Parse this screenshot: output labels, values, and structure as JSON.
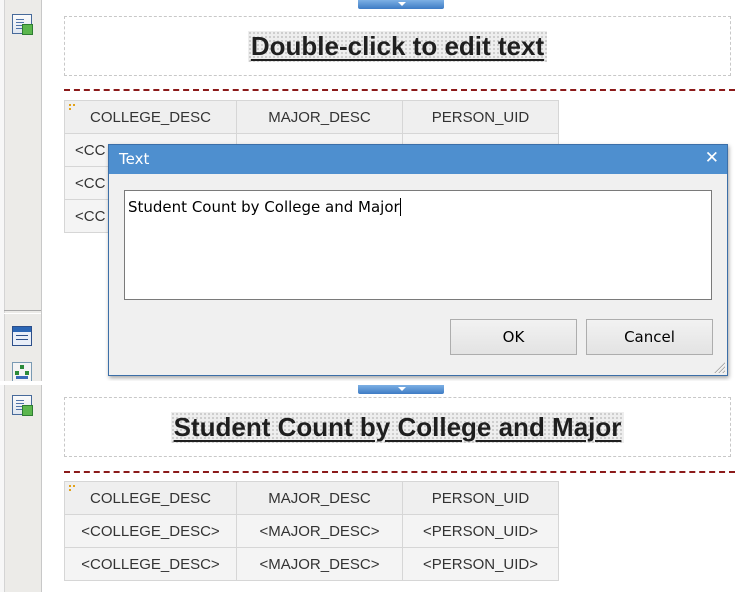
{
  "top_panel": {
    "title_placeholder": "Double-click to edit text",
    "table": {
      "headers": [
        "COLLEGE_DESC",
        "MAJOR_DESC",
        "PERSON_UID"
      ],
      "row_prefix": [
        "<CC",
        "<CC",
        "<CC"
      ]
    },
    "dialog": {
      "title": "Text",
      "close_glyph": "✕",
      "text_value": "Student Count by College and Major",
      "ok_label": "OK",
      "cancel_label": "Cancel"
    }
  },
  "bottom_panel": {
    "title": "Student Count by College and Major",
    "table": {
      "headers": [
        "COLLEGE_DESC",
        "MAJOR_DESC",
        "PERSON_UID"
      ],
      "row": [
        "<COLLEGE_DESC>",
        "<MAJOR_DESC>",
        "<PERSON_UID>"
      ],
      "partial_row": [
        "<COLLEGE_DESC>",
        "<MAJOR_DESC>",
        "<PERSON_UID>"
      ]
    }
  },
  "icons": [
    "page-layout-icon",
    "table-properties-icon",
    "hierarchy-icon"
  ],
  "colors": {
    "dialog_titlebar": "#4e8fcf",
    "section_separator": "#8b1a1a",
    "handle": "#3d7bc4"
  }
}
